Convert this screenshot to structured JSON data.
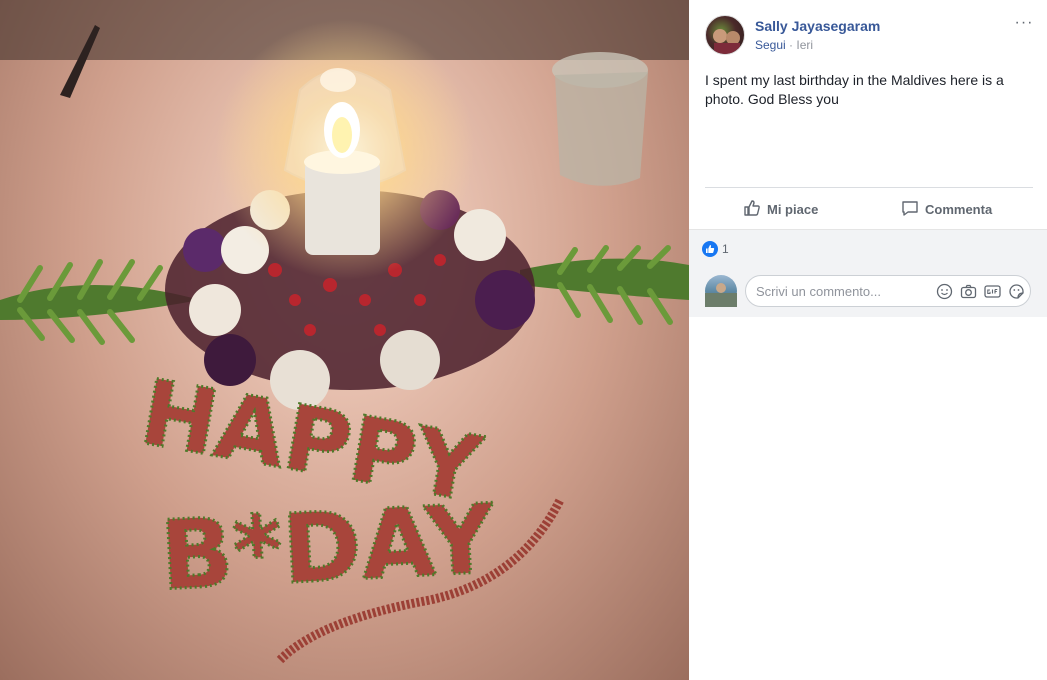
{
  "post": {
    "author": "Sally Jayasegaram",
    "follow_label": "Segui",
    "separator": "·",
    "timestamp": "Ieri",
    "more_label": "···",
    "caption": "I spent my last birthday in the Maldives here is a photo. God Bless you"
  },
  "photo": {
    "text_line1": "HAPPY",
    "text_line2": "B*DAY"
  },
  "actions": {
    "like_label": "Mi piace",
    "comment_label": "Commenta"
  },
  "reactions": {
    "count": "1",
    "icon": "like-bubble-icon",
    "color": "#1877f2"
  },
  "comment_box": {
    "placeholder": "Scrivi un commento...",
    "icons": [
      "emoji-icon",
      "camera-icon",
      "gif-icon",
      "sticker-icon"
    ]
  },
  "colors": {
    "link": "#385898",
    "text": "#1d2129",
    "muted": "#606770",
    "background_secondary": "#f2f3f5"
  }
}
